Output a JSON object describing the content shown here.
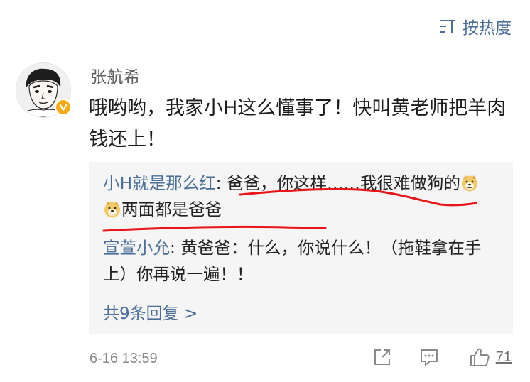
{
  "sort": {
    "label": "按热度"
  },
  "comment": {
    "username": "张航希",
    "text": "哦哟哟，我家小H这么懂事了！快叫黄老师把羊肉钱还上！",
    "verified": true
  },
  "replies": [
    {
      "user": "小H就是那么红",
      "text_before": ": 爸爸，你这样……我很难做狗的",
      "emojis": [
        "doge-emoji",
        "doge-emoji"
      ],
      "text_after": "两面都是爸爸"
    },
    {
      "user": "宣萱小允",
      "text": ": 黄爸爸：什么，你说什么！（拖鞋拿在手上）你再说一遍！！"
    }
  ],
  "more_replies": "共9条回复 >",
  "footer": {
    "time": "6-16 13:59",
    "like_count": "71"
  },
  "colors": {
    "link": "#4b6e98",
    "marker": "#e8151b",
    "badge": "#f4ab12",
    "reply_bg": "#f5f5f5"
  }
}
